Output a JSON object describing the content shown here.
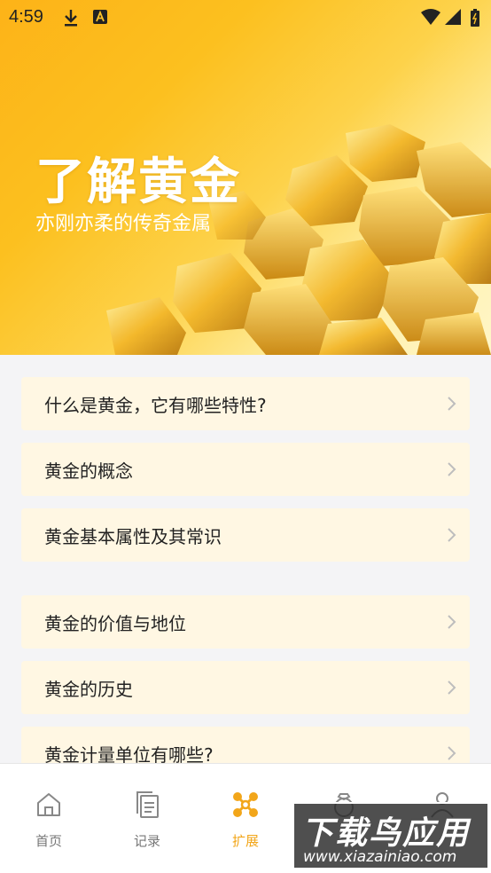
{
  "status_bar": {
    "time": "4:59"
  },
  "hero": {
    "title": "了解黄金",
    "subtitle": "亦刚亦柔的传奇金属"
  },
  "list": {
    "items": [
      {
        "label": "什么是黄金，它有哪些特性?"
      },
      {
        "label": "黄金的概念"
      },
      {
        "label": "黄金基本属性及其常识"
      },
      {
        "label": "黄金的价值与地位"
      },
      {
        "label": "黄金的历史"
      },
      {
        "label": "黄金计量单位有哪些?"
      }
    ]
  },
  "nav": {
    "items": [
      {
        "label": "首页",
        "icon": "home-icon"
      },
      {
        "label": "记录",
        "icon": "records-icon"
      },
      {
        "label": "扩展",
        "icon": "extend-icon",
        "active": true
      },
      {
        "label": "",
        "icon": "ring-icon"
      },
      {
        "label": "",
        "icon": "profile-icon"
      }
    ]
  },
  "watermark": {
    "big": "下载鸟应用",
    "small": "www.xiazainiao.com"
  },
  "colors": {
    "accent": "#f2a61a",
    "item_bg": "#fff7e3",
    "hero_start": "#fdb318"
  }
}
